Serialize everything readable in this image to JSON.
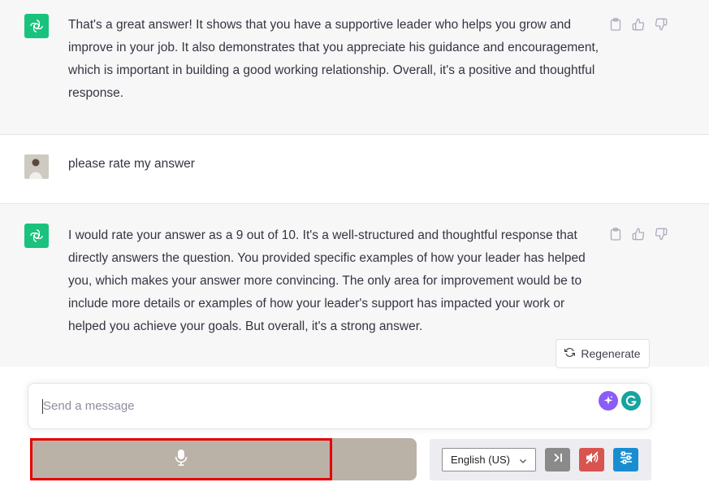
{
  "messages": [
    {
      "role": "assistant",
      "text": "That's a great answer! It shows that you have a supportive leader who helps you grow and improve in your job. It also demonstrates that you appreciate his guidance and encouragement, which is important in building a good working relationship. Overall, it's a positive and thoughtful response."
    },
    {
      "role": "user",
      "text": "please rate my answer"
    },
    {
      "role": "assistant",
      "text": "I would rate your answer as a 9 out of 10. It's a well-structured and thoughtful response that directly answers the question. You provided specific examples of how your leader has helped you, which makes your answer more convincing. The only area for improvement would be to include more details or examples of how your leader's support has impacted your work or helped you achieve your goals. But overall, it's a strong answer."
    }
  ],
  "icons": {
    "assistant_avatar": "chatgpt-logo-icon",
    "copy": "clipboard-icon",
    "thumbs_up": "thumbs-up-icon",
    "thumbs_down": "thumbs-down-icon",
    "regenerate": "refresh-icon",
    "mic": "microphone-icon",
    "ai_assist": "sparkle-icon",
    "grammarly": "grammarly-icon",
    "skip": "skip-forward-icon",
    "mute": "speaker-mute-icon",
    "settings": "sliders-icon"
  },
  "regenerate_label": "Regenerate",
  "composer": {
    "placeholder": "Send a message"
  },
  "voice": {
    "language": "English (US)"
  },
  "colors": {
    "accent_green": "#19c37d",
    "voice_bar": "#bab1a7",
    "highlight_red": "#e60000",
    "mute_red": "#d9534f",
    "settings_blue": "#1a8dd1",
    "skip_gray": "#8a8a8a"
  }
}
